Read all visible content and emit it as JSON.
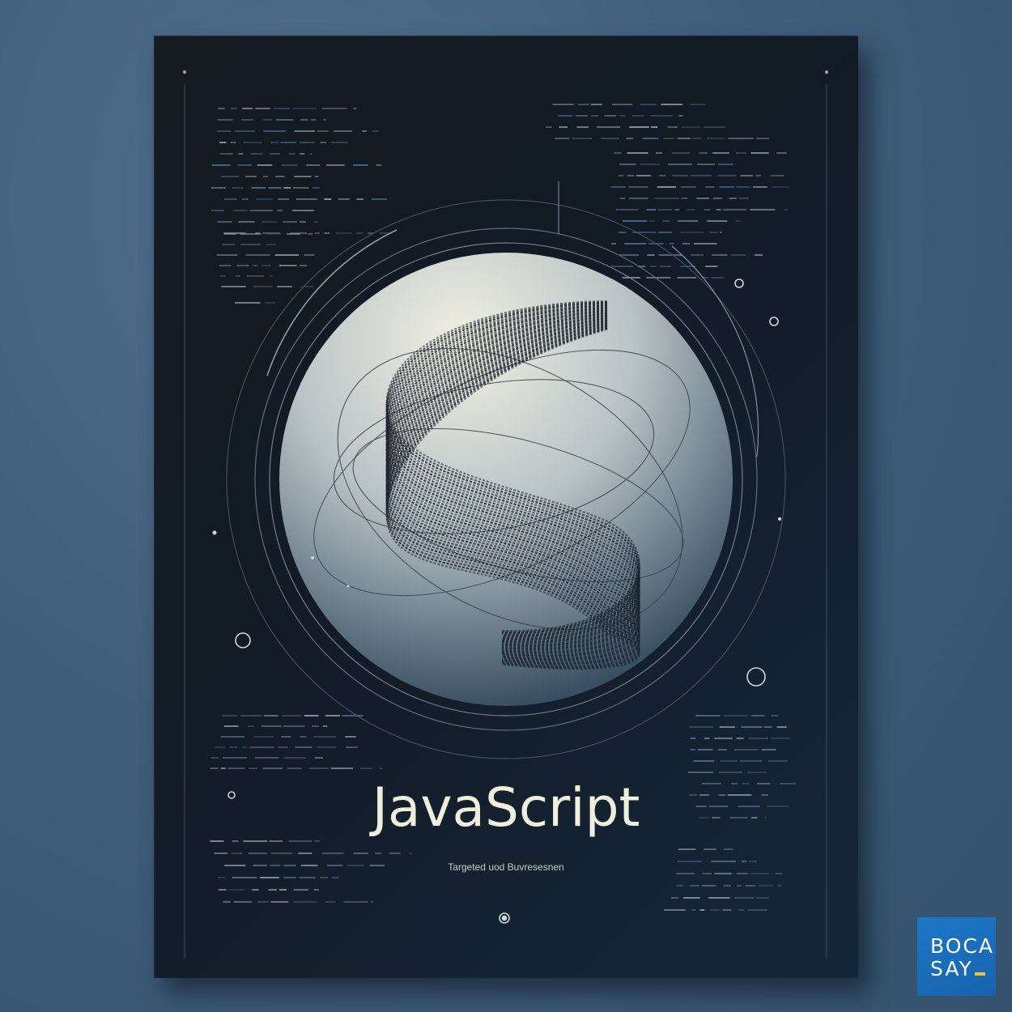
{
  "book": {
    "title": "JavaScript",
    "subtitle": "Targeted uod Buvresesnen"
  },
  "logo": {
    "line1": "BOCA",
    "line2": "SAY"
  },
  "colors": {
    "background": "#3f5f7d",
    "cover": "#121a24",
    "title": "#eef0dc",
    "logo_bg": "#1a6dbc",
    "logo_accent": "#f2c230"
  }
}
